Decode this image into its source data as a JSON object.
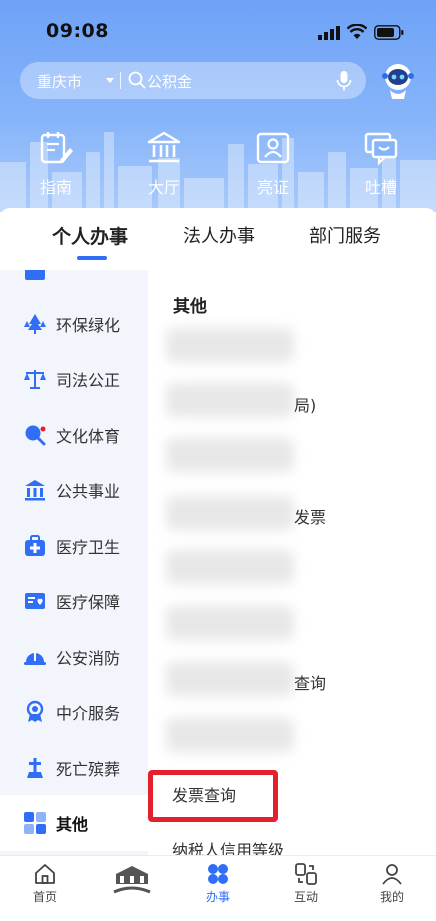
{
  "status": {
    "time": "09:08"
  },
  "search": {
    "city": "重庆市",
    "placeholder": "公积金"
  },
  "quick_actions": [
    {
      "label": "指南",
      "icon": "guide-icon"
    },
    {
      "label": "大厅",
      "icon": "hall-icon"
    },
    {
      "label": "亮证",
      "icon": "id-card-icon"
    },
    {
      "label": "吐槽",
      "icon": "feedback-icon"
    }
  ],
  "tabs": [
    {
      "label": "个人办事",
      "active": true
    },
    {
      "label": "法人办事",
      "active": false
    },
    {
      "label": "部门服务",
      "active": false
    }
  ],
  "sidebar": {
    "items": [
      {
        "label": "环保绿化",
        "icon": "tree-icon"
      },
      {
        "label": "司法公正",
        "icon": "scales-icon"
      },
      {
        "label": "文化体育",
        "icon": "ping-pong-icon"
      },
      {
        "label": "公共事业",
        "icon": "building-icon"
      },
      {
        "label": "医疗卫生",
        "icon": "medical-kit-icon"
      },
      {
        "label": "医疗保障",
        "icon": "medical-card-icon"
      },
      {
        "label": "公安消防",
        "icon": "helmet-icon"
      },
      {
        "label": "中介服务",
        "icon": "badge-icon"
      },
      {
        "label": "死亡殡葬",
        "icon": "tombstone-icon"
      },
      {
        "label": "其他",
        "icon": "grid-icon",
        "active": true
      }
    ]
  },
  "content": {
    "section_title": "其他",
    "items": [
      {
        "visible_text": "局)"
      },
      {
        "visible_text": "发票"
      },
      {
        "visible_text": "查询"
      },
      {
        "visible_text": "发票查询",
        "highlighted": true
      },
      {
        "visible_text": "纳税人信用等级"
      }
    ]
  },
  "bottom_nav": [
    {
      "label": "首页",
      "icon": "home-icon"
    },
    {
      "label": "",
      "icon": "app-logo-icon"
    },
    {
      "label": "办事",
      "icon": "services-icon",
      "active": true
    },
    {
      "label": "互动",
      "icon": "interact-icon"
    },
    {
      "label": "我的",
      "icon": "user-icon"
    }
  ],
  "colors": {
    "accent": "#2f6ef5",
    "highlight": "#e3202b",
    "hero": "#7aa9f8"
  }
}
